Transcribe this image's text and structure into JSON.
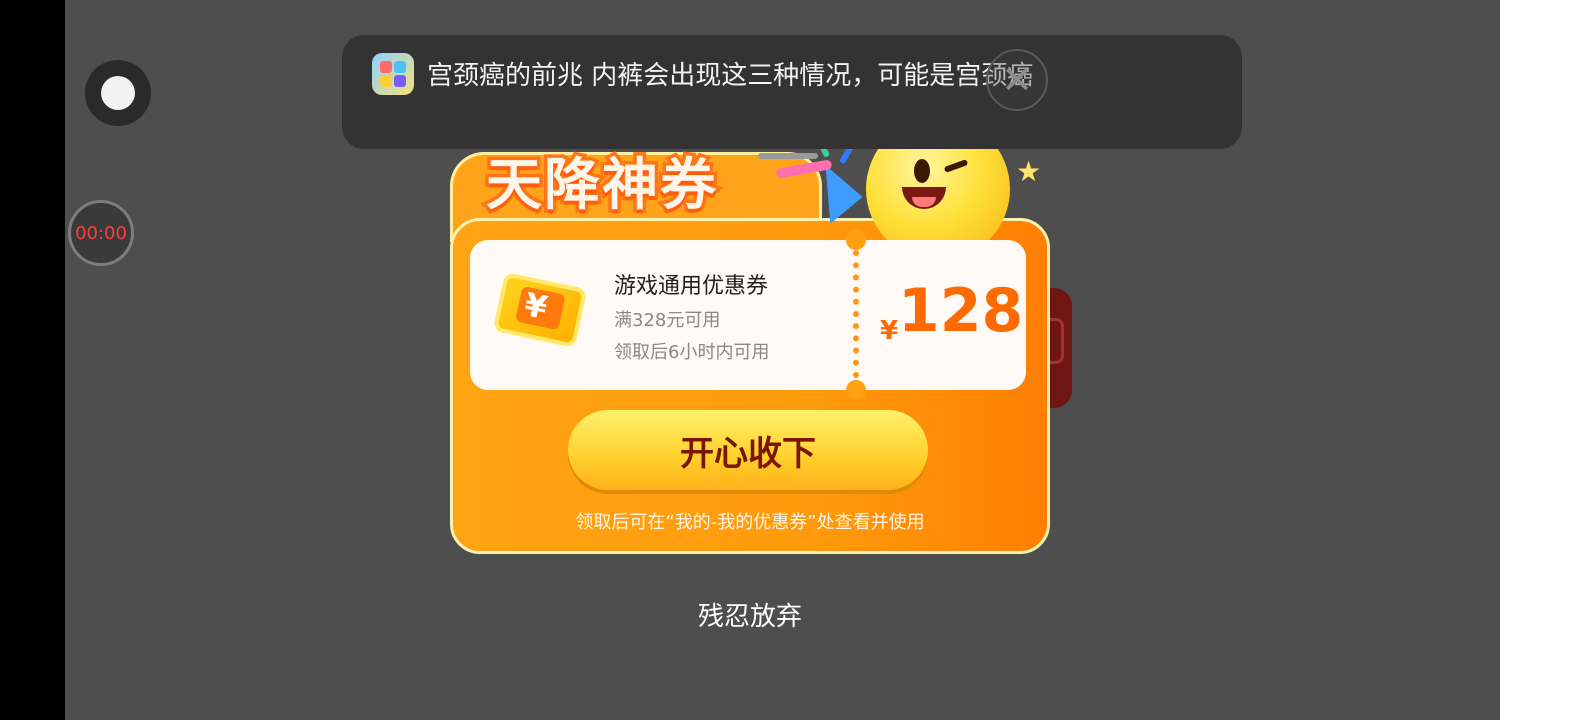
{
  "notification": {
    "text": "宫颈癌的前兆 内裤会出现这三种情况，可能是宫颈癌",
    "close_symbol": "✕"
  },
  "recorder": {
    "timer": "00:00"
  },
  "coupon_popup": {
    "title": "天降神券",
    "coupon_name": "游戏通用优惠券",
    "condition": "满328元可用",
    "validity": "领取后6小时内可用",
    "currency_symbol": "¥",
    "amount": "128",
    "accept_label": "开心收下",
    "hint": "领取后可在“我的-我的优惠券”处查看并使用",
    "ticket_icon_symbol": "¥"
  },
  "reject_label": "残忍放弃",
  "colors": {
    "accent": "#ff6a00",
    "card_orange": "#ffa413",
    "button_yellow": "#ffd02d",
    "button_text": "#7b1400",
    "overlay_gray": "#4e4e4e"
  }
}
